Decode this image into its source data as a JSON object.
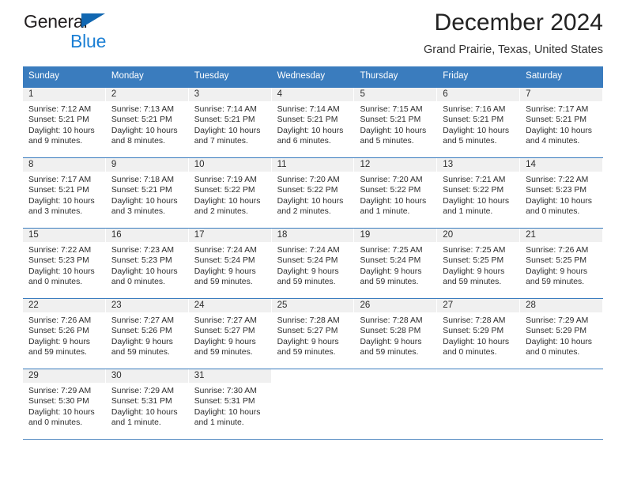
{
  "brand": {
    "name_part1": "General",
    "name_part2": "Blue",
    "triangle_color": "#1167b1",
    "blue_text_color": "#1b7fd4"
  },
  "header": {
    "title": "December 2024",
    "location": "Grand Prairie, Texas, United States"
  },
  "theme": {
    "header_row_color": "#3a7cbe",
    "daynum_band_color": "#f0f0f0",
    "row_divider_color": "#3a7cbe",
    "text_color": "#2d2d2d"
  },
  "weekdays": [
    "Sunday",
    "Monday",
    "Tuesday",
    "Wednesday",
    "Thursday",
    "Friday",
    "Saturday"
  ],
  "weeks": [
    [
      {
        "day": "1",
        "sunrise": "Sunrise: 7:12 AM",
        "sunset": "Sunset: 5:21 PM",
        "daylight1": "Daylight: 10 hours",
        "daylight2": "and 9 minutes."
      },
      {
        "day": "2",
        "sunrise": "Sunrise: 7:13 AM",
        "sunset": "Sunset: 5:21 PM",
        "daylight1": "Daylight: 10 hours",
        "daylight2": "and 8 minutes."
      },
      {
        "day": "3",
        "sunrise": "Sunrise: 7:14 AM",
        "sunset": "Sunset: 5:21 PM",
        "daylight1": "Daylight: 10 hours",
        "daylight2": "and 7 minutes."
      },
      {
        "day": "4",
        "sunrise": "Sunrise: 7:14 AM",
        "sunset": "Sunset: 5:21 PM",
        "daylight1": "Daylight: 10 hours",
        "daylight2": "and 6 minutes."
      },
      {
        "day": "5",
        "sunrise": "Sunrise: 7:15 AM",
        "sunset": "Sunset: 5:21 PM",
        "daylight1": "Daylight: 10 hours",
        "daylight2": "and 5 minutes."
      },
      {
        "day": "6",
        "sunrise": "Sunrise: 7:16 AM",
        "sunset": "Sunset: 5:21 PM",
        "daylight1": "Daylight: 10 hours",
        "daylight2": "and 5 minutes."
      },
      {
        "day": "7",
        "sunrise": "Sunrise: 7:17 AM",
        "sunset": "Sunset: 5:21 PM",
        "daylight1": "Daylight: 10 hours",
        "daylight2": "and 4 minutes."
      }
    ],
    [
      {
        "day": "8",
        "sunrise": "Sunrise: 7:17 AM",
        "sunset": "Sunset: 5:21 PM",
        "daylight1": "Daylight: 10 hours",
        "daylight2": "and 3 minutes."
      },
      {
        "day": "9",
        "sunrise": "Sunrise: 7:18 AM",
        "sunset": "Sunset: 5:21 PM",
        "daylight1": "Daylight: 10 hours",
        "daylight2": "and 3 minutes."
      },
      {
        "day": "10",
        "sunrise": "Sunrise: 7:19 AM",
        "sunset": "Sunset: 5:22 PM",
        "daylight1": "Daylight: 10 hours",
        "daylight2": "and 2 minutes."
      },
      {
        "day": "11",
        "sunrise": "Sunrise: 7:20 AM",
        "sunset": "Sunset: 5:22 PM",
        "daylight1": "Daylight: 10 hours",
        "daylight2": "and 2 minutes."
      },
      {
        "day": "12",
        "sunrise": "Sunrise: 7:20 AM",
        "sunset": "Sunset: 5:22 PM",
        "daylight1": "Daylight: 10 hours",
        "daylight2": "and 1 minute."
      },
      {
        "day": "13",
        "sunrise": "Sunrise: 7:21 AM",
        "sunset": "Sunset: 5:22 PM",
        "daylight1": "Daylight: 10 hours",
        "daylight2": "and 1 minute."
      },
      {
        "day": "14",
        "sunrise": "Sunrise: 7:22 AM",
        "sunset": "Sunset: 5:23 PM",
        "daylight1": "Daylight: 10 hours",
        "daylight2": "and 0 minutes."
      }
    ],
    [
      {
        "day": "15",
        "sunrise": "Sunrise: 7:22 AM",
        "sunset": "Sunset: 5:23 PM",
        "daylight1": "Daylight: 10 hours",
        "daylight2": "and 0 minutes."
      },
      {
        "day": "16",
        "sunrise": "Sunrise: 7:23 AM",
        "sunset": "Sunset: 5:23 PM",
        "daylight1": "Daylight: 10 hours",
        "daylight2": "and 0 minutes."
      },
      {
        "day": "17",
        "sunrise": "Sunrise: 7:24 AM",
        "sunset": "Sunset: 5:24 PM",
        "daylight1": "Daylight: 9 hours",
        "daylight2": "and 59 minutes."
      },
      {
        "day": "18",
        "sunrise": "Sunrise: 7:24 AM",
        "sunset": "Sunset: 5:24 PM",
        "daylight1": "Daylight: 9 hours",
        "daylight2": "and 59 minutes."
      },
      {
        "day": "19",
        "sunrise": "Sunrise: 7:25 AM",
        "sunset": "Sunset: 5:24 PM",
        "daylight1": "Daylight: 9 hours",
        "daylight2": "and 59 minutes."
      },
      {
        "day": "20",
        "sunrise": "Sunrise: 7:25 AM",
        "sunset": "Sunset: 5:25 PM",
        "daylight1": "Daylight: 9 hours",
        "daylight2": "and 59 minutes."
      },
      {
        "day": "21",
        "sunrise": "Sunrise: 7:26 AM",
        "sunset": "Sunset: 5:25 PM",
        "daylight1": "Daylight: 9 hours",
        "daylight2": "and 59 minutes."
      }
    ],
    [
      {
        "day": "22",
        "sunrise": "Sunrise: 7:26 AM",
        "sunset": "Sunset: 5:26 PM",
        "daylight1": "Daylight: 9 hours",
        "daylight2": "and 59 minutes."
      },
      {
        "day": "23",
        "sunrise": "Sunrise: 7:27 AM",
        "sunset": "Sunset: 5:26 PM",
        "daylight1": "Daylight: 9 hours",
        "daylight2": "and 59 minutes."
      },
      {
        "day": "24",
        "sunrise": "Sunrise: 7:27 AM",
        "sunset": "Sunset: 5:27 PM",
        "daylight1": "Daylight: 9 hours",
        "daylight2": "and 59 minutes."
      },
      {
        "day": "25",
        "sunrise": "Sunrise: 7:28 AM",
        "sunset": "Sunset: 5:27 PM",
        "daylight1": "Daylight: 9 hours",
        "daylight2": "and 59 minutes."
      },
      {
        "day": "26",
        "sunrise": "Sunrise: 7:28 AM",
        "sunset": "Sunset: 5:28 PM",
        "daylight1": "Daylight: 9 hours",
        "daylight2": "and 59 minutes."
      },
      {
        "day": "27",
        "sunrise": "Sunrise: 7:28 AM",
        "sunset": "Sunset: 5:29 PM",
        "daylight1": "Daylight: 10 hours",
        "daylight2": "and 0 minutes."
      },
      {
        "day": "28",
        "sunrise": "Sunrise: 7:29 AM",
        "sunset": "Sunset: 5:29 PM",
        "daylight1": "Daylight: 10 hours",
        "daylight2": "and 0 minutes."
      }
    ],
    [
      {
        "day": "29",
        "sunrise": "Sunrise: 7:29 AM",
        "sunset": "Sunset: 5:30 PM",
        "daylight1": "Daylight: 10 hours",
        "daylight2": "and 0 minutes."
      },
      {
        "day": "30",
        "sunrise": "Sunrise: 7:29 AM",
        "sunset": "Sunset: 5:31 PM",
        "daylight1": "Daylight: 10 hours",
        "daylight2": "and 1 minute."
      },
      {
        "day": "31",
        "sunrise": "Sunrise: 7:30 AM",
        "sunset": "Sunset: 5:31 PM",
        "daylight1": "Daylight: 10 hours",
        "daylight2": "and 1 minute."
      },
      {
        "day": "",
        "sunrise": "",
        "sunset": "",
        "daylight1": "",
        "daylight2": ""
      },
      {
        "day": "",
        "sunrise": "",
        "sunset": "",
        "daylight1": "",
        "daylight2": ""
      },
      {
        "day": "",
        "sunrise": "",
        "sunset": "",
        "daylight1": "",
        "daylight2": ""
      },
      {
        "day": "",
        "sunrise": "",
        "sunset": "",
        "daylight1": "",
        "daylight2": ""
      }
    ]
  ]
}
